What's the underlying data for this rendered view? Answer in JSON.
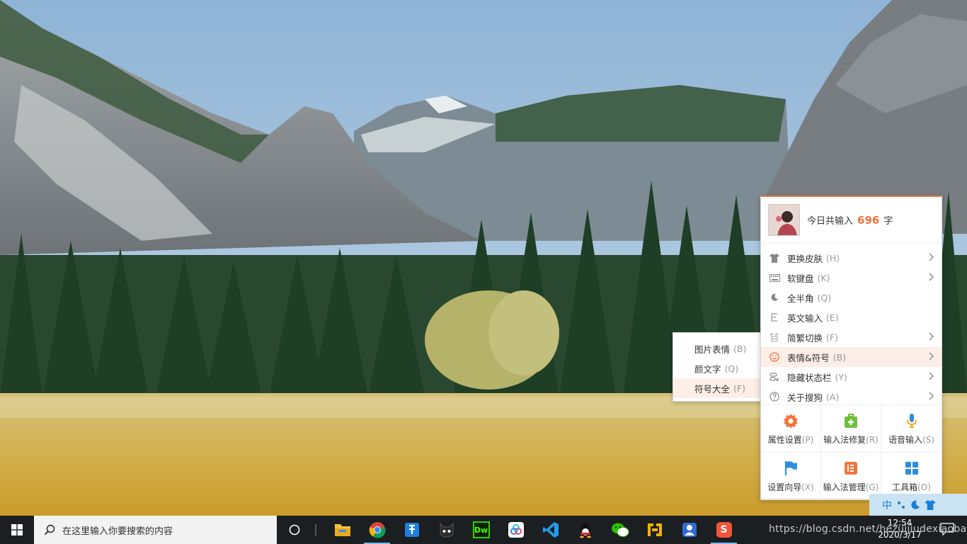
{
  "taskbar": {
    "search_placeholder": "在这里输入你要搜索的内容",
    "apps": [
      {
        "name": "file-explorer"
      },
      {
        "name": "chrome"
      },
      {
        "name": "pinned-app"
      },
      {
        "name": "cat-app"
      },
      {
        "name": "dreamweaver",
        "label": "Dw"
      },
      {
        "name": "baidu-netdisk"
      },
      {
        "name": "vscode"
      },
      {
        "name": "qq"
      },
      {
        "name": "wechat"
      },
      {
        "name": "yellow-app"
      },
      {
        "name": "blue-app"
      },
      {
        "name": "sogou",
        "label": "S"
      }
    ],
    "watermark": "https://blog.csdn.net/hezuijiudexiaobai",
    "time": "12:54",
    "date": "2020/3/17"
  },
  "sogou_menu": {
    "stat_prefix": "今日共输入",
    "stat_count": "696",
    "stat_suffix": "字",
    "items": [
      {
        "label": "更换皮肤",
        "key": "(H)"
      },
      {
        "label": "软键盘",
        "key": "(K)"
      },
      {
        "label": "全半角",
        "key": "(Q)"
      },
      {
        "label": "英文输入",
        "key": "(E)"
      },
      {
        "label": "简繁切换",
        "key": "(F)"
      },
      {
        "label": "表情&符号",
        "key": "(B)"
      },
      {
        "label": "隐藏状态栏",
        "key": "(Y)"
      },
      {
        "label": "关于搜狗",
        "key": "(A)"
      }
    ],
    "grid": [
      {
        "label": "属性设置",
        "key": "(P)"
      },
      {
        "label": "输入法修复",
        "key": "(R)"
      },
      {
        "label": "语音输入",
        "key": "(S)"
      },
      {
        "label": "设置向导",
        "key": "(X)"
      },
      {
        "label": "输入法管理",
        "key": "(G)"
      },
      {
        "label": "工具箱",
        "key": "(O)"
      }
    ]
  },
  "submenu": {
    "items": [
      {
        "label": "图片表情",
        "key": "(B)"
      },
      {
        "label": "颜文字",
        "key": "(Q)"
      },
      {
        "label": "符号大全",
        "key": "(F)"
      }
    ]
  },
  "ime_bar": {
    "lang": "中"
  },
  "colors": {
    "accent": "#f2743a",
    "hover": "#fdeee7",
    "taskbar": "#1c1f22"
  }
}
